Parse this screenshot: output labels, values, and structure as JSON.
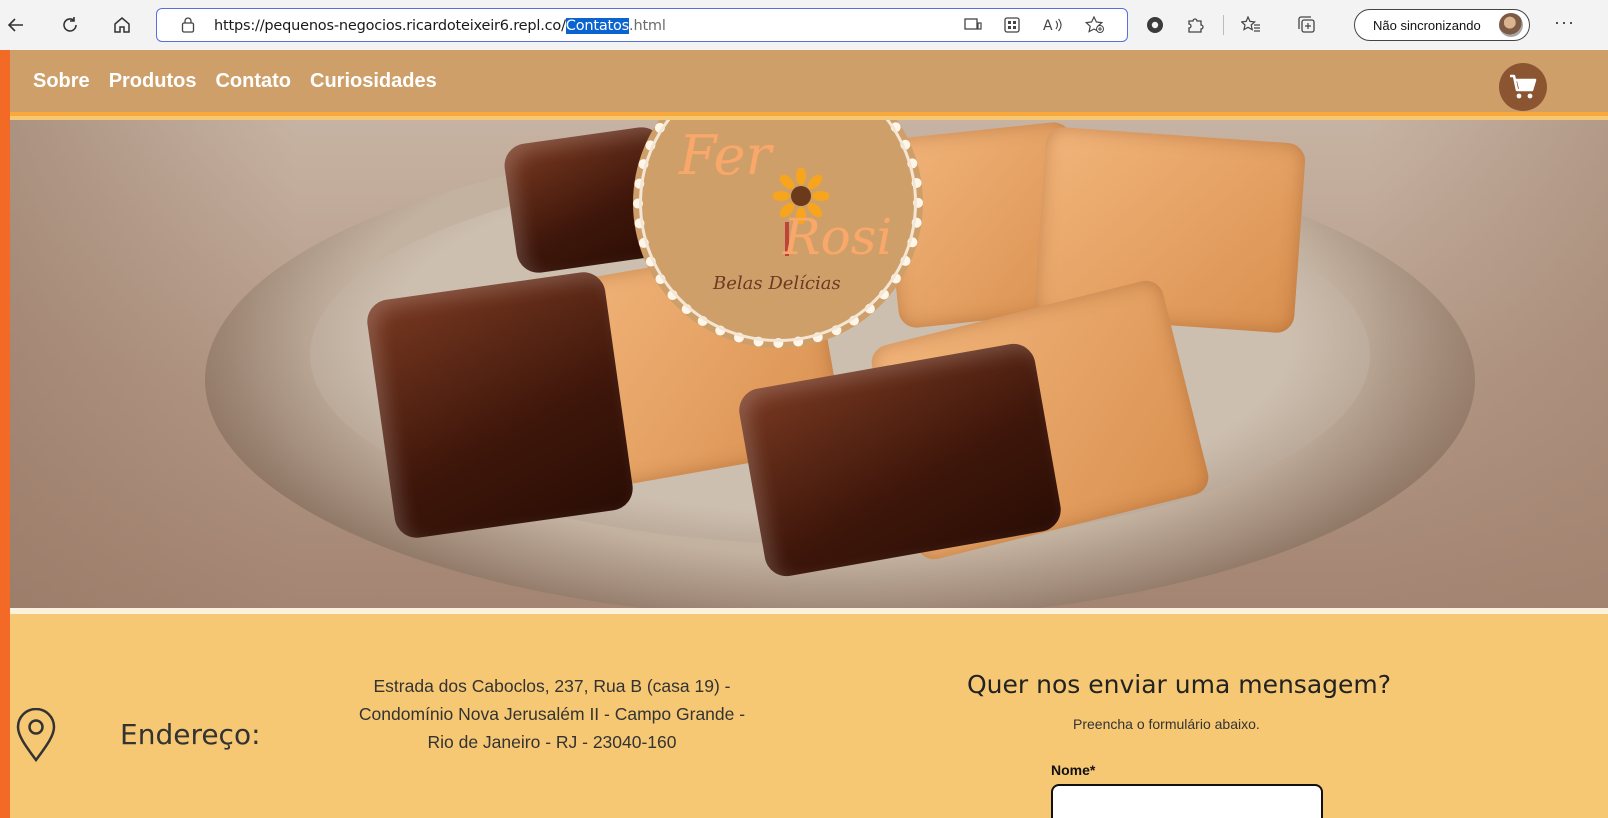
{
  "browser": {
    "url_prefix": "https://pequenos-negocios.ricardoteixeir6.repl.co/",
    "url_highlight": "Contatos",
    "url_suffix": ".html",
    "sync_label": "Não sincronizando",
    "more_label": "···",
    "icons": [
      "back-icon",
      "refresh-icon",
      "home-icon",
      "lock-icon",
      "app-view-icon",
      "grid-icon",
      "read-aloud-icon",
      "favorite-add-icon",
      "extension-icon",
      "puzzle-icon",
      "favorites-icon",
      "collections-icon"
    ]
  },
  "site": {
    "nav": [
      "Sobre",
      "Produtos",
      "Contato",
      "Curiosidades"
    ],
    "logo": {
      "line1": "Fer",
      "line2": "Rosi",
      "tagline": "Belas Delícias"
    },
    "colors": {
      "nav_bg": "#cf9f6a",
      "accent": "#f9a93c",
      "content_bg": "#f6c873",
      "frame": "#f26a25"
    }
  },
  "contact": {
    "address_label": "Endereço:",
    "address_lines": [
      "Estrada dos Caboclos, 237, Rua B (casa 19) -",
      "Condomínio Nova Jerusalém II - Campo Grande -",
      "Rio de Janeiro - RJ - 23040-160"
    ],
    "form_title": "Quer nos enviar uma mensagem?",
    "form_subtitle": "Preencha o formulário abaixo.",
    "name_label": "Nome*",
    "name_value": ""
  }
}
